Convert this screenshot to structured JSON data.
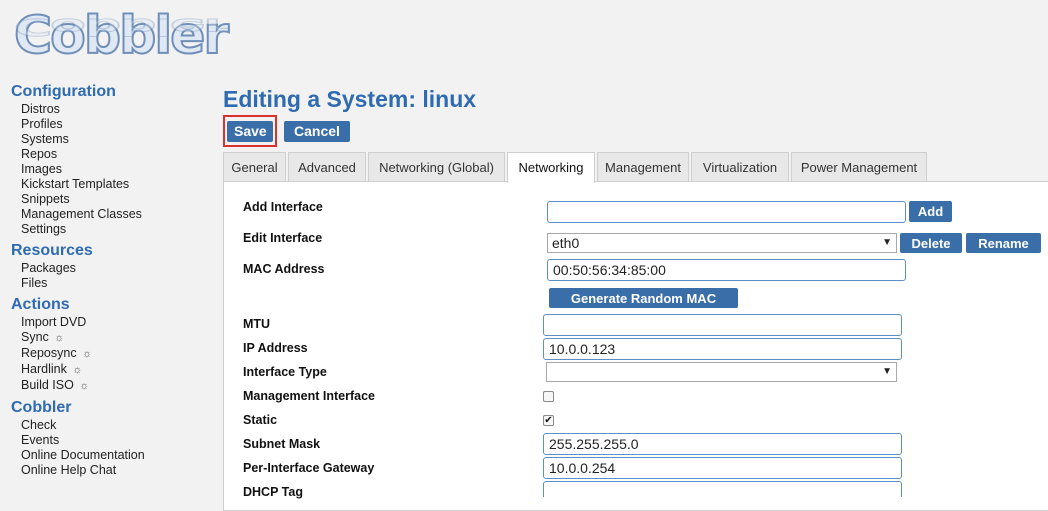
{
  "logo": {
    "text": "Cobbler"
  },
  "sidebar": {
    "sections": [
      {
        "title": "Configuration",
        "items": [
          "Distros",
          "Profiles",
          "Systems",
          "Repos",
          "Images",
          "Kickstart Templates",
          "Snippets",
          "Management Classes",
          "Settings"
        ]
      },
      {
        "title": "Resources",
        "items": [
          "Packages",
          "Files"
        ]
      },
      {
        "title": "Actions",
        "items": [
          "Import DVD",
          "Sync",
          "Reposync",
          "Hardlink",
          "Build ISO"
        ]
      },
      {
        "title": "Cobbler",
        "items": [
          "Check",
          "Events",
          "Online Documentation",
          "Online Help Chat"
        ]
      }
    ],
    "gear_glyph": "☼"
  },
  "page": {
    "title": "Editing a System: linux",
    "save_label": "Save",
    "cancel_label": "Cancel"
  },
  "tabs": [
    "General",
    "Advanced",
    "Networking (Global)",
    "Networking",
    "Management",
    "Virtualization",
    "Power Management"
  ],
  "active_tab": "Networking",
  "form": {
    "add_interface": {
      "label": "Add Interface",
      "value": "",
      "button": "Add"
    },
    "edit_interface": {
      "label": "Edit Interface",
      "value": "eth0",
      "delete_button": "Delete",
      "rename_button": "Rename"
    },
    "mac_address": {
      "label": "MAC Address",
      "value": "00:50:56:34:85:00",
      "button": "Generate Random MAC"
    },
    "mtu": {
      "label": "MTU",
      "value": ""
    },
    "ip_address": {
      "label": "IP Address",
      "value": "10.0.0.123"
    },
    "interface_type": {
      "label": "Interface Type",
      "value": ""
    },
    "management_interface": {
      "label": "Management Interface",
      "checked": false
    },
    "static": {
      "label": "Static",
      "checked": true,
      "check_glyph": "✔"
    },
    "subnet_mask": {
      "label": "Subnet Mask",
      "value": "255.255.255.0"
    },
    "gateway": {
      "label": "Per-Interface Gateway",
      "value": "10.0.0.254"
    },
    "dhcp_tag": {
      "label": "DHCP Tag",
      "value": ""
    }
  },
  "colors": {
    "accent": "#2f6bb0",
    "button": "#3a6ea8",
    "highlight": "#d9312f"
  }
}
